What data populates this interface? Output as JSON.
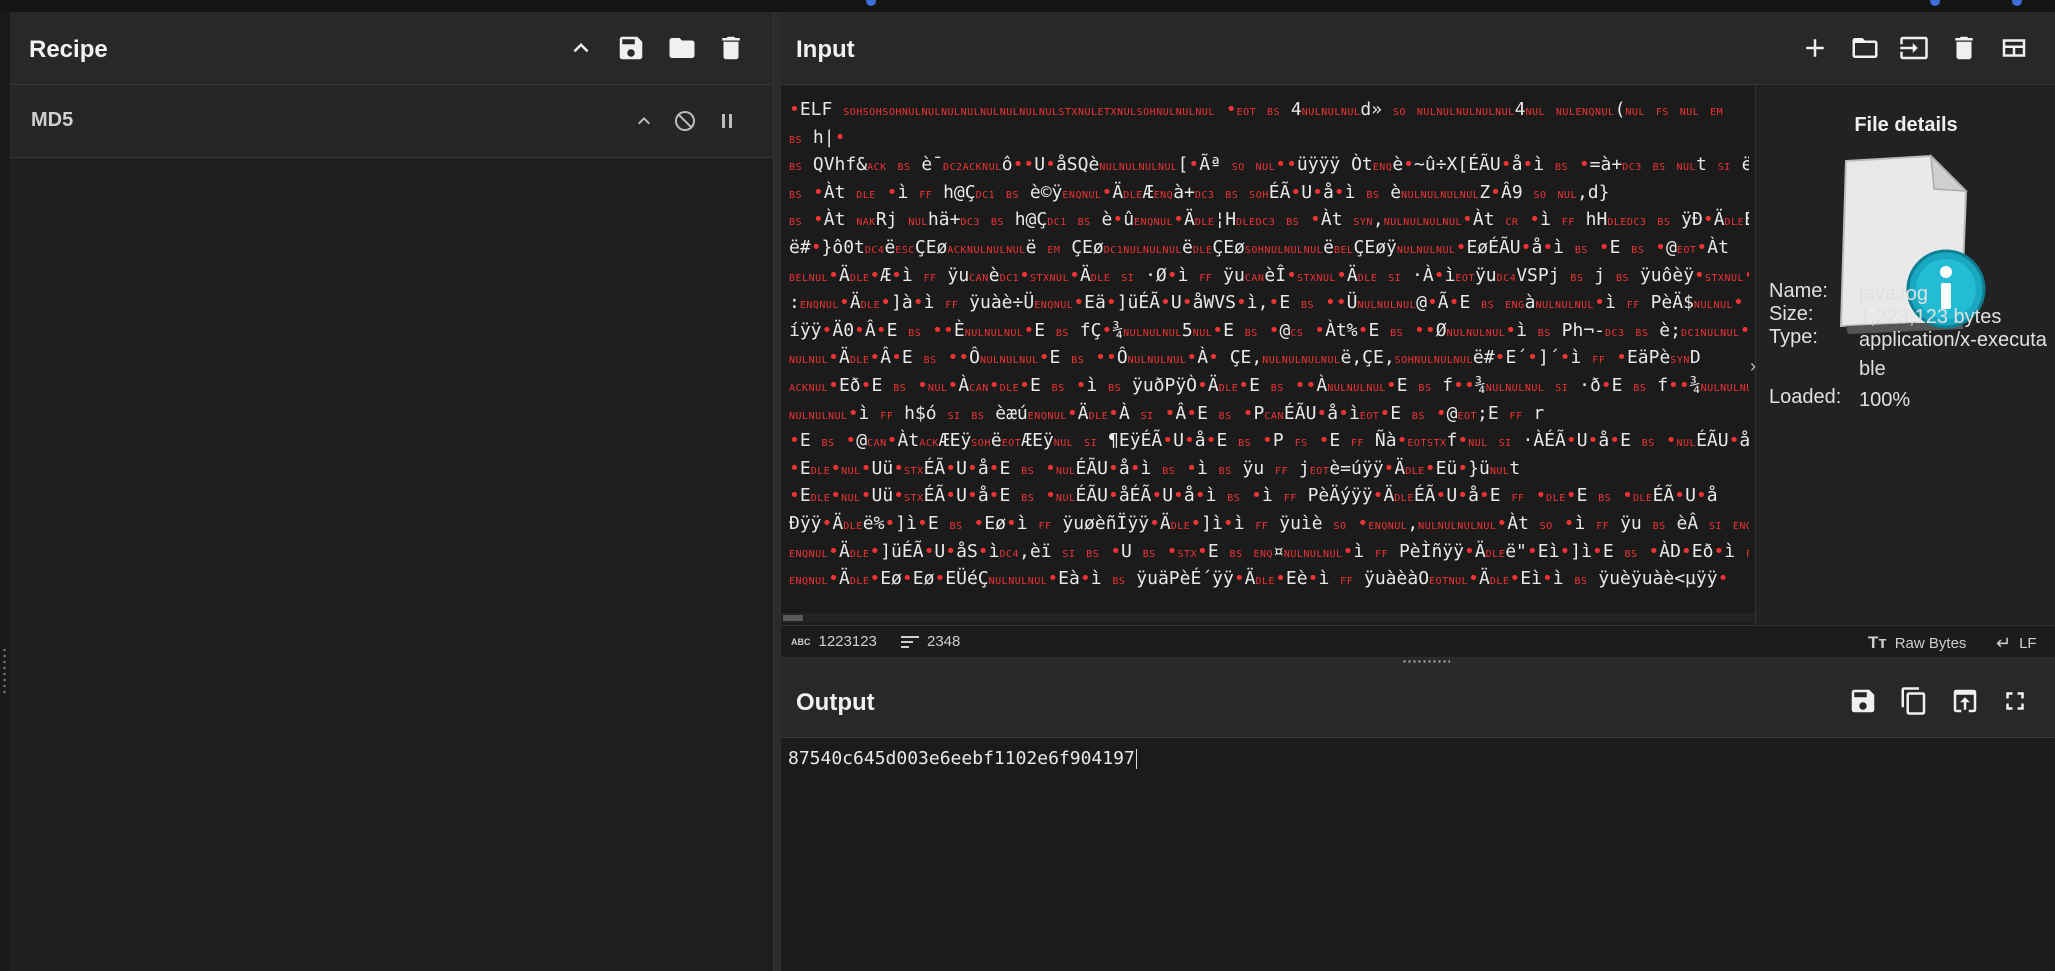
{
  "recipe": {
    "title": "Recipe",
    "operations": [
      {
        "name": "MD5"
      }
    ]
  },
  "input": {
    "title": "Input",
    "lines": [
      "•ELF SOHSOHSOHNULNULNULNULNULNULNULNULSTXNULETXNULSOHNULNULNUL •EOT BS 4NULNULNULd» SO NULNULNULNULNUL4NUL NULENQNUL(NUL FS NUL EM",
      "BS h|•",
      "BS QVhf&ACK BS è¯DC2ACKNULô••U•åSQèNULNULNULNUL[•Ãª SO NUL••üÿÿÿ ÒtENQè•~û÷X[ÉÃU•å•ì BS •=à+DC3 BS NULt SI ë",
      "BS •Àt DLE •ì FF h@ÇDC1 BS è©ÿENQNUL•ÄDLEÆENQà+DC3 BS SOHÉÃ•U•å•ì BS èNULNULNULNULZ•Â9 SO NUL,d}",
      "BS •Àt NAKRj NULhä+DC3 BS h@ÇDC1 BS è•ûENQNUL•ÄDLE¦HDLEDC3 BS •Àt SYN,NULNULNULNUL•Àt CR •ì FF hHDLEDC3 BS ÿÐ•ÄDLEÉÃ•••U",
      "ë#•}ô0tDC4ëESCÇEøACKNULNULNULë EM ÇEøDC1NULNULNULëDLEÇEøSOHNULNULNULëBELÇEøÿNULNULNUL•EøÉÃU•å•ì BS •E BS •@EOT•Àt",
      "BELNUL•ÄDLE•Æ•ì FF ÿuCANèDC1•STXNUL•ÄDLE SI ·Ø•ì FF ÿuCANèÎ•STXNUL•ÄDLE SI ·À•ìEOTÿuDC4VSPj BS j BS ÿuôèÿ•STXNUL•Ä",
      ":ENQNUL•ÄDLE•]à•ì FF ÿuàè÷ÜENQNUL•Eä•]üÉÃ•U•åWVS•ì,•E BS ••ÜNULNULNUL@•Ã•E BS ENGàNULNULNUL•ì FF PèÄ$NULNUL•",
      "íÿÿ•Ä0•Â•E BS ••ÈNULNULNUL•E BS fÇ•¾NULNULNUL5NUL•E BS •@CS •Àt%•E BS ••ØNULNULNUL•ì BS Ph¬-DC3 BS è;DC1NULNUL•ÄDLE",
      "NULNUL•ÄDLE•Â•E BS ••ÔNULNULNUL•E BS ••ÔNULNULNUL•À•   ÇE,NULNULNULNULë,ÇE,SOHNULNULNULë#•E´•]´•ì FF •EäPèSYND",
      "ACKNUL•Eð•E BS •NUL•ÀCAN•DLE•E BS •ì BS ÿuðPÿÒ•ÄDLE•E BS ••ÀNULNULNUL•E BS f••¾NULNULNUL SI ·ð•E BS f••¾NULNULNUL SI ·",
      "NULNULNUL•ì FF h$ó SI BS èæúENQNUL•ÄDLE•À SI •Â•E BS •PCANÉÃU•å•ìEOT•E BS •@EOT;E FF r",
      "•E BS •@CAN•ÀtACKÆEÿSOHëEOTÆEÿNUL SI ¶EÿÉÃ•U•å•E BS •P FS •E FF Ñà•EOTSTXf•NUL SI ·ÀÉÃ•U•å•E BS •NULÉÃU•å•ì BS",
      "•EDLE•NUL•Uü•STXÉÃ•U•å•E BS •NULÉÃU•å•ì BS •ì BS ÿu FF jEOTè=úÿÿ•ÄDLE•Eü•}üNULt",
      "•EDLE•NUL•Uü•STXÉÃ•U•å•E BS •NULÉÃU•åÉÃ•U•å•ì BS •ì FF PèÄýÿÿ•ÄDLEÉÃ•U•å•E FF •DLE•E BS •DLEÉÃ•U•å",
      "Ðÿÿ•ÄDLEë%•]ì•E BS •Eø•ì FF ÿuøèñÏÿÿ•ÄDLE•]ì•ì FF ÿuìè SO •ENQNUL,NULNULNULNUL•Àt SO •ì FF ÿu BS èÂ SI ENQNUL•Ä",
      "ENQNUL•ÄDLE•]üÉÃ•U•åS•ìDC4,èï SI BS •U BS •STX•E BS ENQ¤NULNULNUL•ì FF PèÌñÿÿ•ÄDLEë\"•Eì•]ì•E BS •ÀD•Eð•ì FF ÿ",
      "ENQNUL•ÄDLE•Eø•Eø•EÜéÇNULNULNUL•Eà•ì BS ÿuäPèÉ´ÿÿ•ÄDLE•Eè•ì FF ÿuàèàOEOTNUL•ÄDLE•Eì•ì BS ÿuèÿuàè<µÿÿ•"
    ],
    "status": {
      "length": "1223123",
      "lines": "2348",
      "charset": "Raw Bytes",
      "eol": "LF"
    }
  },
  "file_details": {
    "title": "File details",
    "name_label": "Name:",
    "name": "java.log",
    "size_label": "Size:",
    "size": "1,223,123 bytes",
    "type_label": "Type:",
    "type": "application/x-executable",
    "loaded_label": "Loaded:",
    "loaded": "100%"
  },
  "output": {
    "title": "Output",
    "value": "87540c645d003e6eebf1102e6f904197"
  },
  "colors": {
    "accent_icon": "#1fb2c9",
    "control_char": "#e33333",
    "background": "#1e1e1e"
  }
}
